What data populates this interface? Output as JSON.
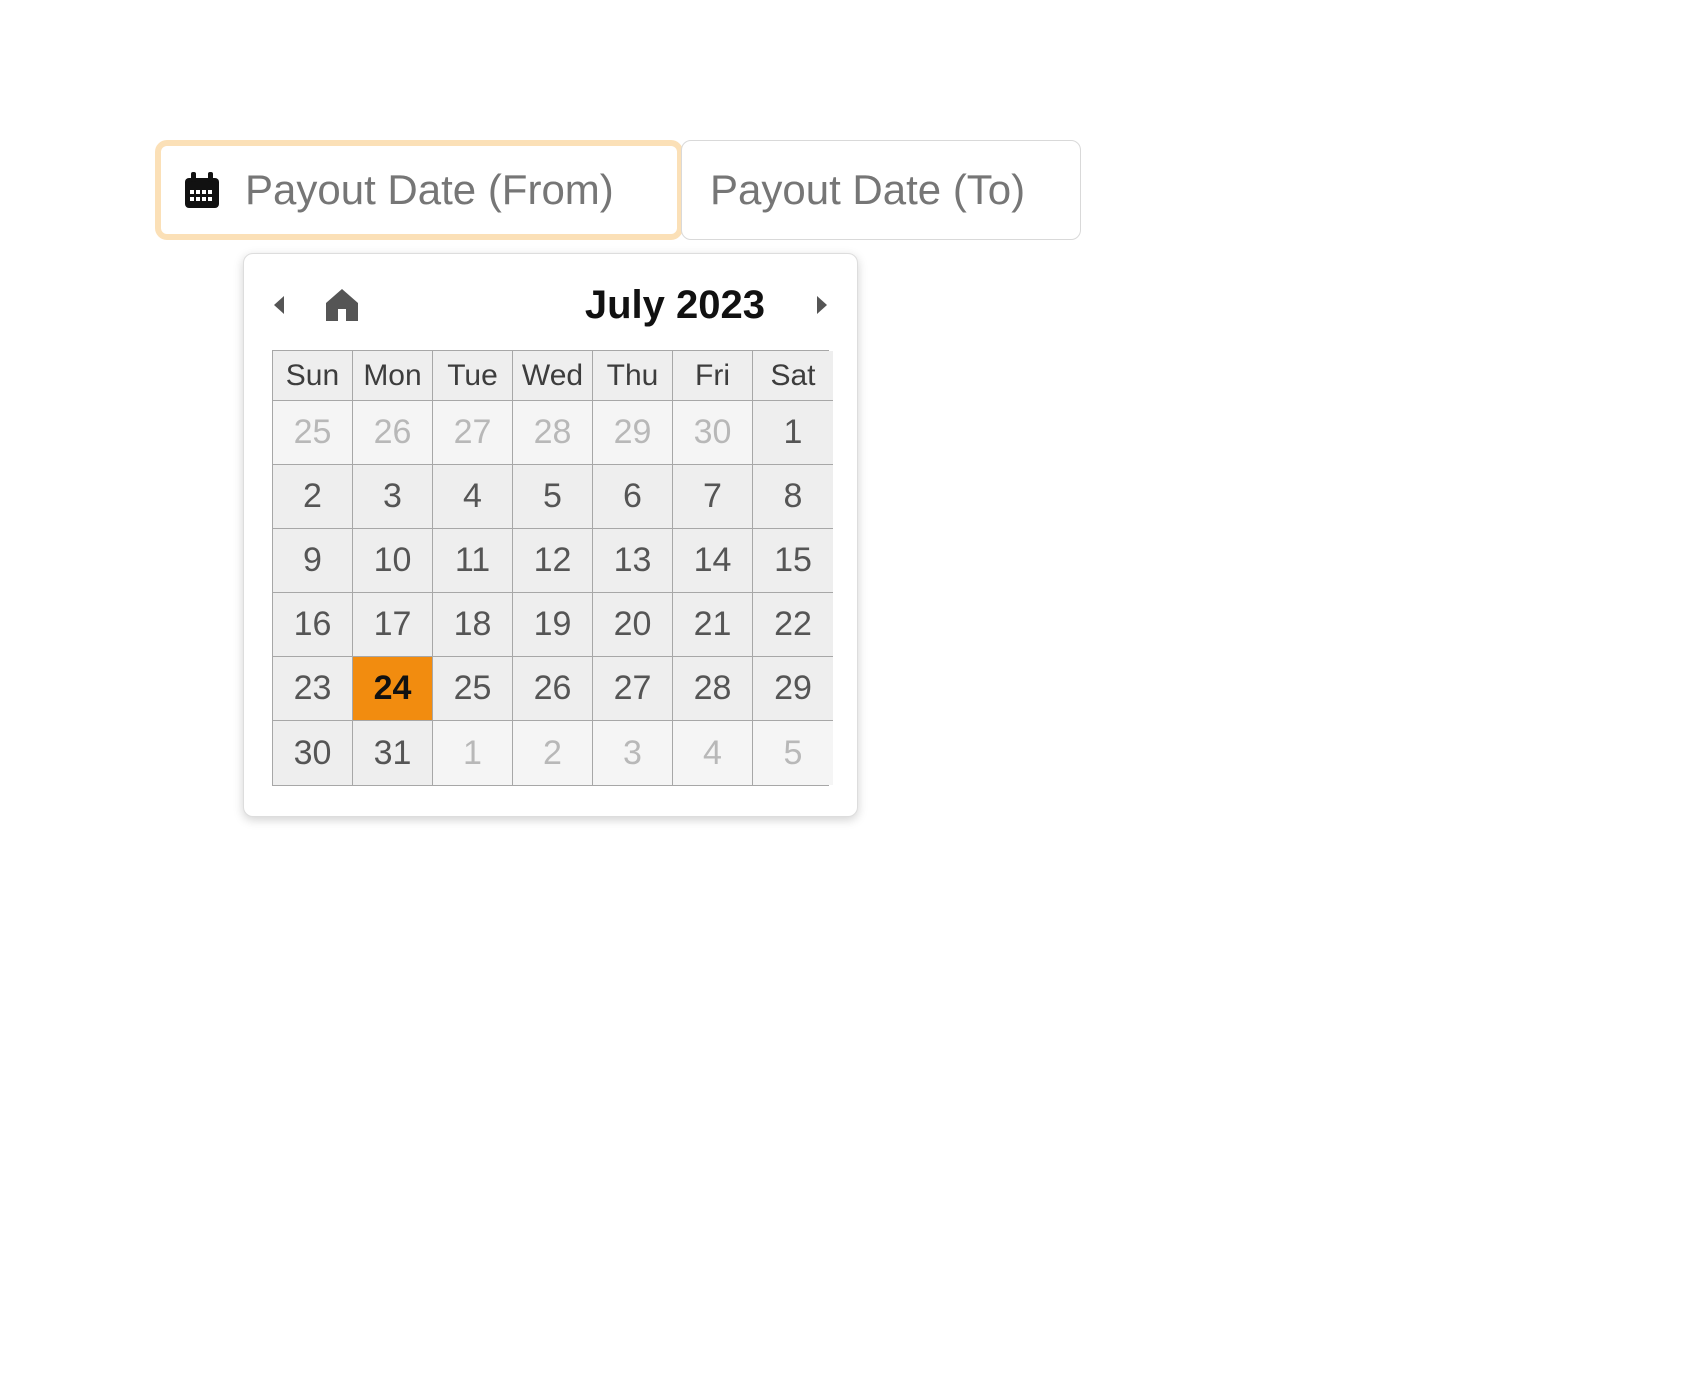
{
  "inputs": {
    "from_placeholder": "Payout Date (From)",
    "to_placeholder": "Payout Date (To)"
  },
  "datepicker": {
    "title": "July 2023",
    "dow": [
      "Sun",
      "Mon",
      "Tue",
      "Wed",
      "Thu",
      "Fri",
      "Sat"
    ],
    "cells": [
      {
        "d": "25",
        "out": true
      },
      {
        "d": "26",
        "out": true
      },
      {
        "d": "27",
        "out": true
      },
      {
        "d": "28",
        "out": true
      },
      {
        "d": "29",
        "out": true
      },
      {
        "d": "30",
        "out": true
      },
      {
        "d": "1"
      },
      {
        "d": "2"
      },
      {
        "d": "3"
      },
      {
        "d": "4"
      },
      {
        "d": "5"
      },
      {
        "d": "6"
      },
      {
        "d": "7"
      },
      {
        "d": "8"
      },
      {
        "d": "9"
      },
      {
        "d": "10"
      },
      {
        "d": "11"
      },
      {
        "d": "12"
      },
      {
        "d": "13"
      },
      {
        "d": "14"
      },
      {
        "d": "15"
      },
      {
        "d": "16"
      },
      {
        "d": "17"
      },
      {
        "d": "18"
      },
      {
        "d": "19"
      },
      {
        "d": "20"
      },
      {
        "d": "21"
      },
      {
        "d": "22"
      },
      {
        "d": "23"
      },
      {
        "d": "24",
        "today": true
      },
      {
        "d": "25"
      },
      {
        "d": "26"
      },
      {
        "d": "27"
      },
      {
        "d": "28"
      },
      {
        "d": "29"
      },
      {
        "d": "30"
      },
      {
        "d": "31"
      },
      {
        "d": "1",
        "out": true
      },
      {
        "d": "2",
        "out": true
      },
      {
        "d": "3",
        "out": true
      },
      {
        "d": "4",
        "out": true
      },
      {
        "d": "5",
        "out": true
      }
    ]
  }
}
